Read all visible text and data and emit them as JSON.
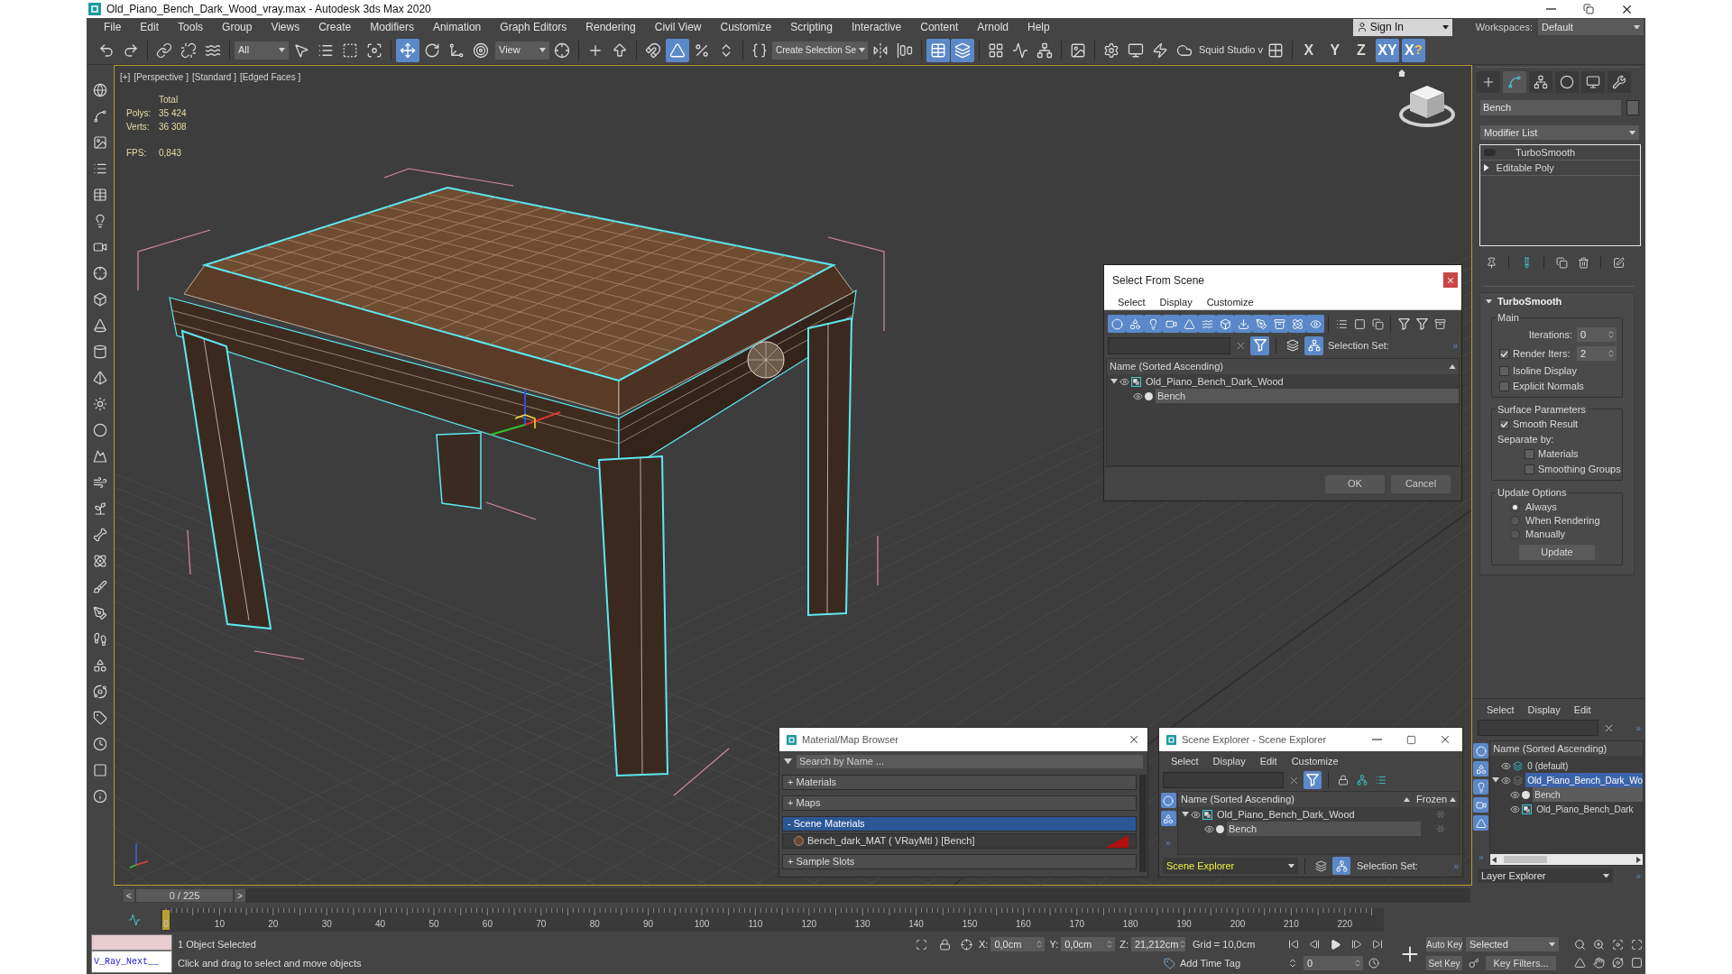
{
  "window": {
    "title": "Old_Piano_Bench_Dark_Wood_vray.max - Autodesk 3ds Max 2020"
  },
  "menu": [
    "File",
    "Edit",
    "Tools",
    "Group",
    "Views",
    "Create",
    "Modifiers",
    "Animation",
    "Graph Editors",
    "Rendering",
    "Civil View",
    "Customize",
    "Scripting",
    "Interactive",
    "Content",
    "Arnold",
    "Help"
  ],
  "account": {
    "label": "Sign In"
  },
  "workspaces": {
    "label": "Workspaces:",
    "value": "Default"
  },
  "toolbar": {
    "selection_filter": "All",
    "transform_tools": [
      {
        "selected": true
      },
      {
        "selected": false
      },
      {
        "selected": false
      },
      {
        "selected": false
      }
    ],
    "reference_coordinate": "View",
    "snap_toggles": [
      {
        "selected": false
      },
      {
        "selected": true
      },
      {
        "selected": false
      },
      {
        "selected": false
      }
    ],
    "named_selection": "Create Selection Se",
    "explorer_toggles": [
      {
        "selected": true
      },
      {
        "selected": true
      }
    ],
    "render_preset": "Squid Studio v",
    "axis_constraints": [
      {
        "label": "X",
        "selected": false
      },
      {
        "label": "Y",
        "selected": false
      },
      {
        "label": "Z",
        "selected": false
      },
      {
        "label": "XY",
        "selected": true
      },
      {
        "label": "X",
        "badge": "?",
        "selected": true
      }
    ]
  },
  "viewport": {
    "labels": [
      "[+]",
      "[Perspective ]",
      "[Standard ]",
      "[Edged Faces ]"
    ],
    "stats": {
      "heading": "Total",
      "rows": [
        {
          "label": "Polys:",
          "value": "35 424"
        },
        {
          "label": "Verts:",
          "value": "36 308"
        }
      ],
      "fps_label": "FPS:",
      "fps": "0,843"
    }
  },
  "select_dialog": {
    "title": "Select From Scene",
    "menu": [
      "Select",
      "Display",
      "Customize"
    ],
    "filters": [
      {
        "selected": true
      },
      {
        "selected": true
      },
      {
        "selected": true
      },
      {
        "selected": true
      },
      {
        "selected": true
      },
      {
        "selected": true
      },
      {
        "selected": true
      },
      {
        "selected": true
      },
      {
        "selected": true
      },
      {
        "selected": true
      },
      {
        "selected": true
      },
      {
        "selected": true
      }
    ],
    "view_toggles": [
      {
        "selected": true
      },
      {
        "selected": false
      },
      {
        "selected": true
      }
    ],
    "selection_set": "Selection Set:",
    "overflow": "»",
    "column": "Name (Sorted Ascending)",
    "tree": [
      {
        "label": "Old_Piano_Bench_Dark_Wood",
        "kind": "group",
        "expanded": true,
        "selected": false,
        "children": [
          {
            "label": "Bench",
            "kind": "object",
            "selected": true
          }
        ]
      }
    ],
    "buttons": [
      "OK",
      "Cancel"
    ]
  },
  "material_browser": {
    "title": "Material/Map Browser",
    "search": {
      "placeholder": "Search by Name ..."
    },
    "groups": [
      {
        "label": "+ Materials",
        "selected": false
      },
      {
        "label": "+ Maps",
        "selected": false
      },
      {
        "label": "- Scene Materials",
        "selected": true,
        "items": [
          "Bench_dark_MAT ( VRayMtl ) [Bench]"
        ]
      },
      {
        "label": "+ Sample Slots",
        "selected": false
      }
    ]
  },
  "scene_explorer": {
    "title": "Scene Explorer - Scene Explorer",
    "menu": [
      "Select",
      "Display",
      "Edit",
      "Customize"
    ],
    "view_toggles": [
      {
        "selected": true
      }
    ],
    "side_filters": [
      {
        "selected": true
      },
      {
        "selected": true
      }
    ],
    "side_overflow": "»",
    "columns": [
      "Name (Sorted Ascending)",
      "Frozen"
    ],
    "tree": [
      {
        "label": "Old_Piano_Bench_Dark_Wood",
        "kind": "group",
        "expanded": true,
        "selected": false,
        "frozen": false,
        "children": [
          {
            "label": "Bench",
            "kind": "object",
            "selected": true,
            "frozen": false
          }
        ]
      }
    ],
    "explorer": "Scene Explorer",
    "explorer_toggles": [
      {
        "selected": false
      },
      {
        "selected": true
      }
    ],
    "selection_set": "Selection Set:",
    "bar_overflow": "»"
  },
  "command_panel": {
    "tabs": [
      {
        "selected": false
      },
      {
        "selected": true
      },
      {
        "selected": false
      },
      {
        "selected": false
      },
      {
        "selected": false
      },
      {
        "selected": false
      }
    ],
    "object_name": "Bench",
    "modifier_list": "Modifier List",
    "stack": [
      {
        "label": "TurboSmooth",
        "kind": "modifier"
      },
      {
        "label": "Editable Poly",
        "kind": "base",
        "expanded": false
      }
    ],
    "rollout": {
      "title": "TurboSmooth",
      "expanded": true,
      "groups": [
        {
          "title": "Main",
          "items": [
            {
              "kind": "spinner",
              "label": "Iterations:",
              "value": "0"
            },
            {
              "kind": "check_spinner",
              "label": "Render Iters:",
              "checked": true,
              "value": "2"
            },
            {
              "kind": "checkbox",
              "label": "Isoline Display",
              "checked": false
            },
            {
              "kind": "checkbox",
              "label": "Explicit Normals",
              "checked": false
            }
          ]
        },
        {
          "title": "Surface Parameters",
          "items": [
            {
              "kind": "checkbox",
              "label": "Smooth Result",
              "checked": true
            },
            {
              "kind": "label",
              "label": "Separate by:",
              "children": [
                {
                  "kind": "checkbox",
                  "label": "Materials",
                  "checked": false
                },
                {
                  "kind": "checkbox",
                  "label": "Smoothing Groups",
                  "checked": false
                }
              ]
            }
          ]
        },
        {
          "title": "Update Options",
          "items": [
            {
              "kind": "radio",
              "label": "Always",
              "selected": true
            },
            {
              "kind": "radio",
              "label": "When Rendering",
              "selected": false
            },
            {
              "kind": "radio",
              "label": "Manually",
              "selected": false
            },
            {
              "kind": "button",
              "label": "Update"
            }
          ]
        }
      ]
    }
  },
  "layer_explorer": {
    "menu": [
      "Select",
      "Display",
      "Edit"
    ],
    "toolbar_overflow": "»",
    "side_filters": [
      {
        "selected": true
      },
      {
        "selected": true
      },
      {
        "selected": true
      },
      {
        "selected": true
      },
      {
        "selected": true
      }
    ],
    "side_overflow": "»",
    "column": "Name (Sorted Ascending)",
    "tree": [
      {
        "label": "0 (default)",
        "kind": "layer",
        "current": true,
        "selected": false
      },
      {
        "label": "Old_Piano_Bench_Dark_Wo",
        "kind": "layer",
        "current": false,
        "selected": true,
        "expanded": true,
        "children": [
          {
            "label": "Bench",
            "kind": "object",
            "selected": true
          },
          {
            "label": "Old_Piano_Bench_Dark",
            "kind": "group",
            "selected": false
          }
        ]
      }
    ],
    "explorer": "Layer Explorer",
    "explorer_overflow": "»"
  },
  "time_slider": {
    "prev": "<",
    "position": "0 / 225",
    "next": ">",
    "level": 0
  },
  "track_bar": {
    "labels": [
      "0",
      "10",
      "20",
      "30",
      "40",
      "50",
      "60",
      "70",
      "80",
      "90",
      "100",
      "110",
      "120",
      "130",
      "140",
      "150",
      "160",
      "170",
      "180",
      "190",
      "200",
      "210",
      "220"
    ]
  },
  "status_bar": {
    "listener_output": "V_Ray_Next__",
    "selection": "1 Object Selected",
    "prompt": "Click and drag to select and move objects",
    "coordinates": [
      {
        "label": "X:",
        "value": "0,0cm"
      },
      {
        "label": "Y:",
        "value": "0,0cm"
      },
      {
        "label": "Z:",
        "value": "21,212cm"
      }
    ],
    "grid": "Grid = 10,0cm",
    "time_tag": "Add Time Tag",
    "frame": "0",
    "auto_key": "Auto Key",
    "key_mode": "Selected",
    "set_key": "Set Key",
    "key_filters": "Key Filters..."
  }
}
